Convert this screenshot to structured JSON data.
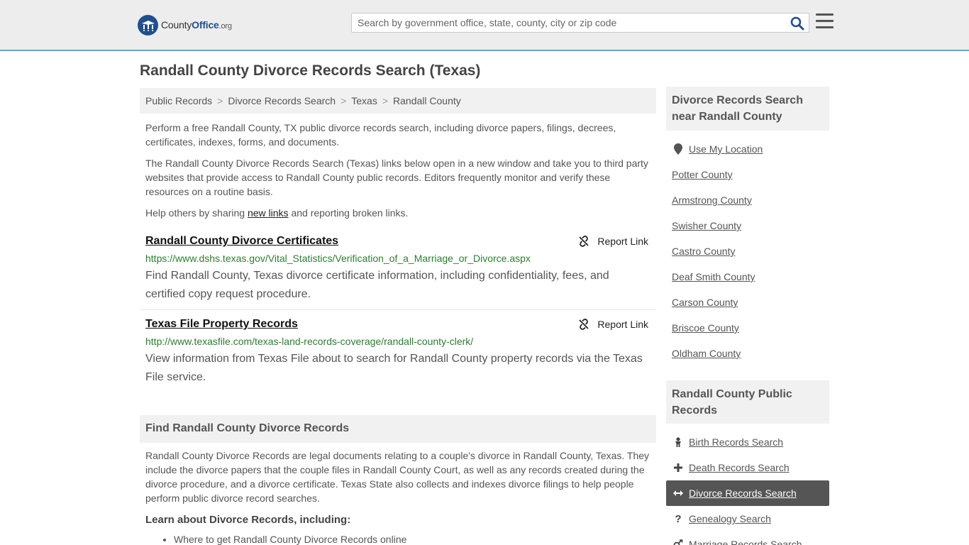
{
  "header": {
    "logo_main": "County",
    "logo_bold": "Office",
    "logo_suffix": ".org",
    "search_placeholder": "Search by government office, state, county, city or zip code"
  },
  "page_title": "Randall County Divorce Records Search (Texas)",
  "breadcrumb": [
    "Public Records",
    "Divorce Records Search",
    "Texas",
    "Randall County"
  ],
  "intro": {
    "p1": "Perform a free Randall County, TX public divorce records search, including divorce papers, filings, decrees, certificates, indexes, forms, and documents.",
    "p2": "The Randall County Divorce Records Search (Texas) links below open in a new window and take you to third party websites that provide access to Randall County public records. Editors frequently monitor and verify these resources on a routine basis.",
    "p3_before": "Help others by sharing ",
    "p3_link": "new links",
    "p3_after": " and reporting broken links."
  },
  "results": [
    {
      "title": "Randall County Divorce Certificates",
      "url": "https://www.dshs.texas.gov/Vital_Statistics/Verification_of_a_Marriage_or_Divorce.aspx",
      "description": "Find Randall County, Texas divorce certificate information, including confidentiality, fees, and certified copy request procedure.",
      "report_label": "Report Link"
    },
    {
      "title": "Texas File Property Records",
      "url": "http://www.texasfile.com/texas-land-records-coverage/randall-county-clerk/",
      "description": "View information from Texas File about to search for Randall County property records via the Texas File service.",
      "report_label": "Report Link"
    }
  ],
  "find_section": {
    "heading": "Find Randall County Divorce Records",
    "body": "Randall County Divorce Records are legal documents relating to a couple's divorce in Randall County, Texas. They include the divorce papers that the couple files in Randall County Court, as well as any records created during the divorce procedure, and a divorce certificate. Texas State also collects and indexes divorce filings to help people perform public divorce record searches.",
    "learn_heading": "Learn about Divorce Records, including:",
    "bullets": [
      "Where to get Randall County Divorce Records online"
    ]
  },
  "sidebar": {
    "nearby_heading": "Divorce Records Search near Randall County",
    "use_location": "Use My Location",
    "nearby": [
      "Potter County",
      "Armstrong County",
      "Swisher County",
      "Castro County",
      "Deaf Smith County",
      "Carson County",
      "Briscoe County",
      "Oldham County"
    ],
    "public_heading": "Randall County Public Records",
    "public_links": [
      {
        "label": "Birth Records Search",
        "icon": "baby-icon"
      },
      {
        "label": "Death Records Search",
        "icon": "cross-icon"
      },
      {
        "label": "Divorce Records Search",
        "icon": "arrows-icon",
        "active": true
      },
      {
        "label": "Genealogy Search",
        "icon": "question-icon"
      },
      {
        "label": "Marriage Records Search",
        "icon": "venus-mars-icon"
      }
    ]
  },
  "colors": {
    "header_bg": "#ededed",
    "header_border": "#6b9fd4",
    "brand_blue": "#1f4f8c",
    "url_green": "#2e7d32",
    "active_bg": "#555555"
  }
}
